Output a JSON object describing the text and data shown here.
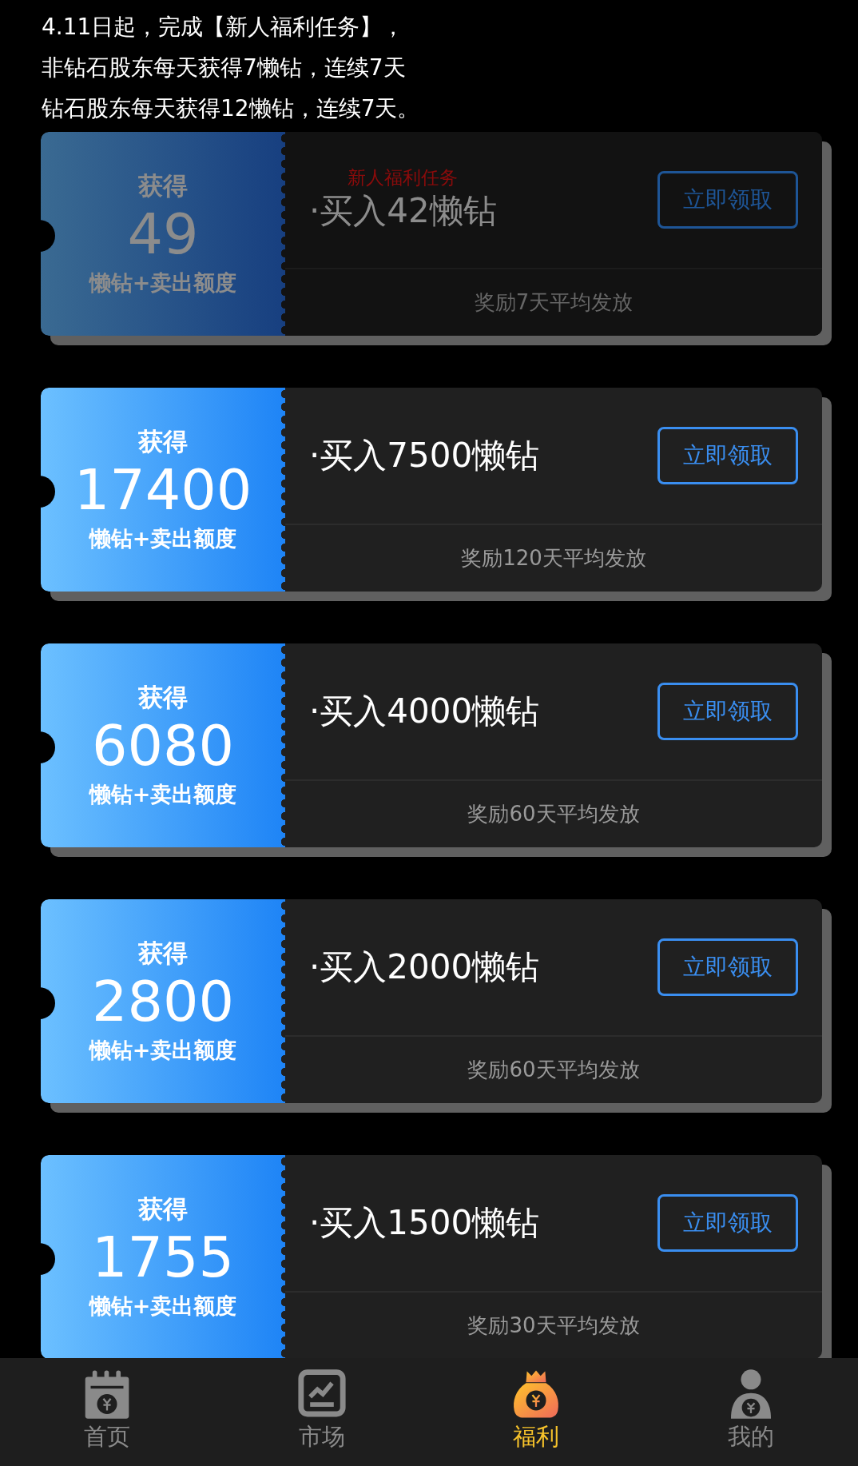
{
  "notice": [
    "4.11日起，完成【新人福利任务】，",
    "非钻石股东每天获得7懒钻，连续7天",
    "钻石股东每天获得12懒钻，连续7天。"
  ],
  "tasks": [
    {
      "disabled": true,
      "tag": "新人福利任务",
      "gain_label": "获得",
      "amount": "49",
      "unit": "懒钻+卖出额度",
      "title": "·买入42懒钻",
      "button": "立即领取",
      "note": "奖励7天平均发放"
    },
    {
      "disabled": false,
      "gain_label": "获得",
      "amount": "17400",
      "unit": "懒钻+卖出额度",
      "title": "·买入7500懒钻",
      "button": "立即领取",
      "note": "奖励120天平均发放"
    },
    {
      "disabled": false,
      "gain_label": "获得",
      "amount": "6080",
      "unit": "懒钻+卖出额度",
      "title": "·买入4000懒钻",
      "button": "立即领取",
      "note": "奖励60天平均发放"
    },
    {
      "disabled": false,
      "gain_label": "获得",
      "amount": "2800",
      "unit": "懒钻+卖出额度",
      "title": "·买入2000懒钻",
      "button": "立即领取",
      "note": "奖励60天平均发放"
    },
    {
      "disabled": false,
      "gain_label": "获得",
      "amount": "1755",
      "unit": "懒钻+卖出额度",
      "title": "·买入1500懒钻",
      "button": "立即领取",
      "note": "奖励30天平均发放"
    }
  ],
  "nav": [
    {
      "label": "首页",
      "selected": false
    },
    {
      "label": "市场",
      "selected": false
    },
    {
      "label": "福利",
      "selected": true
    },
    {
      "label": "我的",
      "selected": false
    }
  ]
}
